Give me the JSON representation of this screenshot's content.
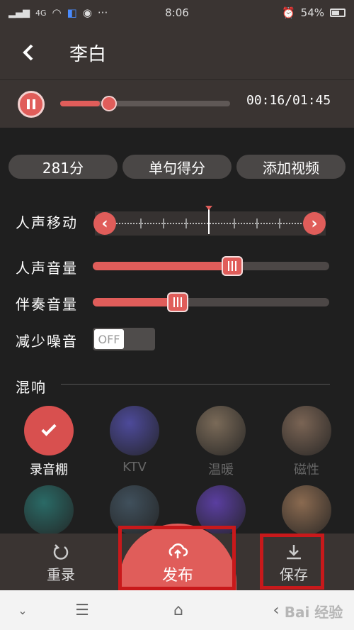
{
  "status_bar": {
    "network": "4G",
    "time": "8:06",
    "battery": "54%"
  },
  "header": {
    "back_icon": "chevron-left-icon",
    "title": "李白"
  },
  "player": {
    "state": "playing",
    "time": "00:16/01:45",
    "progress": 0.15
  },
  "chips": [
    {
      "label": "281分"
    },
    {
      "label": "单句得分"
    },
    {
      "label": "添加视频"
    }
  ],
  "controls": {
    "vocal_shift": {
      "label": "人声移动"
    },
    "vocal_volume": {
      "label": "人声音量",
      "value": 0.59
    },
    "accompaniment_volume": {
      "label": "伴奏音量",
      "value": 0.36
    },
    "noise_reduction": {
      "label": "减少噪音",
      "state": "OFF"
    }
  },
  "reverb": {
    "title": "混响",
    "presets": [
      {
        "label": "录音棚",
        "selected": true,
        "color": "#d8504f"
      },
      {
        "label": "KTV",
        "selected": false,
        "color": "#4d4a9a"
      },
      {
        "label": "温暖",
        "selected": false,
        "color": "#7a6a58"
      },
      {
        "label": "磁性",
        "selected": false,
        "color": "#7a6454"
      },
      {
        "label": "",
        "selected": false,
        "color": "#2a6a66"
      },
      {
        "label": "",
        "selected": false,
        "color": "#40505c"
      },
      {
        "label": "",
        "selected": false,
        "color": "#5a3ea0"
      },
      {
        "label": "",
        "selected": false,
        "color": "#8a6a50"
      }
    ]
  },
  "actions": {
    "rerecord": {
      "label": "重录",
      "icon": "refresh-icon"
    },
    "publish": {
      "label": "发布",
      "icon": "cloud-upload-icon"
    },
    "save": {
      "label": "保存",
      "icon": "download-icon"
    }
  },
  "watermark": "Bai 经验",
  "colors": {
    "accent": "#e05d5a",
    "panel": "#3a3432",
    "background": "#1f1f1f",
    "highlight": "#c8191b"
  }
}
